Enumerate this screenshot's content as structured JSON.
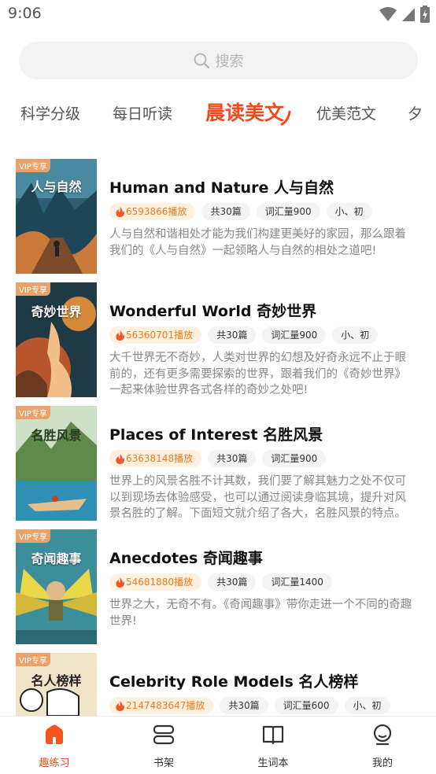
{
  "status_bar": {
    "time": "9:06",
    "icons": [
      "wifi-icon",
      "signal-icon",
      "battery-charging-icon"
    ]
  },
  "search": {
    "placeholder": "搜索",
    "icon": "search-icon"
  },
  "tabs": [
    {
      "label": "科学分级",
      "active": false
    },
    {
      "label": "每日听读",
      "active": false
    },
    {
      "label": "晨读美文",
      "active": true
    },
    {
      "label": "优美范文",
      "active": false
    },
    {
      "label": "夕",
      "active": false
    }
  ],
  "books": [
    {
      "cover_title": "人与自然",
      "vip": "VIP专享",
      "title": "Human and Nature 人与自然",
      "plays": "6593866播放",
      "chapters": "共30篇",
      "vocab": "词汇量900",
      "level": "小、初",
      "desc": "人与自然和谐相处才能为我们构建更美好的家园，那么跟着我们的《人与自然》一起领略人与自然的相处之道吧!"
    },
    {
      "cover_title": "奇妙世界",
      "vip": "VIP专享",
      "title": "Wonderful World 奇妙世界",
      "plays": "56360701播放",
      "chapters": "共30篇",
      "vocab": "词汇量900",
      "level": "小、初",
      "desc": "大千世界无不奇妙，人类对世界的幻想及好奇永远不止于眼前的，还有更多需要探索的世界，跟着我们的《奇妙世界》一起来体验世界各式各样的奇妙之处吧!"
    },
    {
      "cover_title": "名胜风景",
      "vip": "VIP专享",
      "title": "Places of Interest 名胜风景",
      "plays": "63638148播放",
      "chapters": "共30篇",
      "vocab": "词汇量900",
      "level": "",
      "desc": "世界上的风景名胜不计其数，我们要了解其魅力之处不仅可以到现场去体验感受，也可以通过阅读身临其境，提升对风景名胜的了解。下面短文就介绍了各大，名胜风景的特点。"
    },
    {
      "cover_title": "奇闻趣事",
      "vip": "VIP专享",
      "title": "Anecdotes 奇闻趣事",
      "plays": "54681880播放",
      "chapters": "共30篇",
      "vocab": "词汇量1400",
      "level": "",
      "desc": "世界之大，无奇不有。《奇闻趣事》带你走进一个不同的奇趣世界!"
    },
    {
      "cover_title": "名人榜样",
      "vip": "VIP专享",
      "title": "Celebrity Role Models 名人榜样",
      "plays": "2147483647播放",
      "chapters": "共30篇",
      "vocab": "词汇量600",
      "level": "小、初",
      "desc": ""
    }
  ],
  "bottom_nav": [
    {
      "label": "趣练习",
      "icon": "home-icon",
      "active": true
    },
    {
      "label": "书架",
      "icon": "bookshelf-icon",
      "active": false
    },
    {
      "label": "生词本",
      "icon": "open-book-icon",
      "active": false
    },
    {
      "label": "我的",
      "icon": "profile-icon",
      "active": false
    }
  ],
  "colors": {
    "accent": "#f24a1c",
    "plays_tag_bg": "#fff1e0",
    "plays_tag_text": "#f07a1a",
    "vip_badge": "#e8a26a"
  }
}
